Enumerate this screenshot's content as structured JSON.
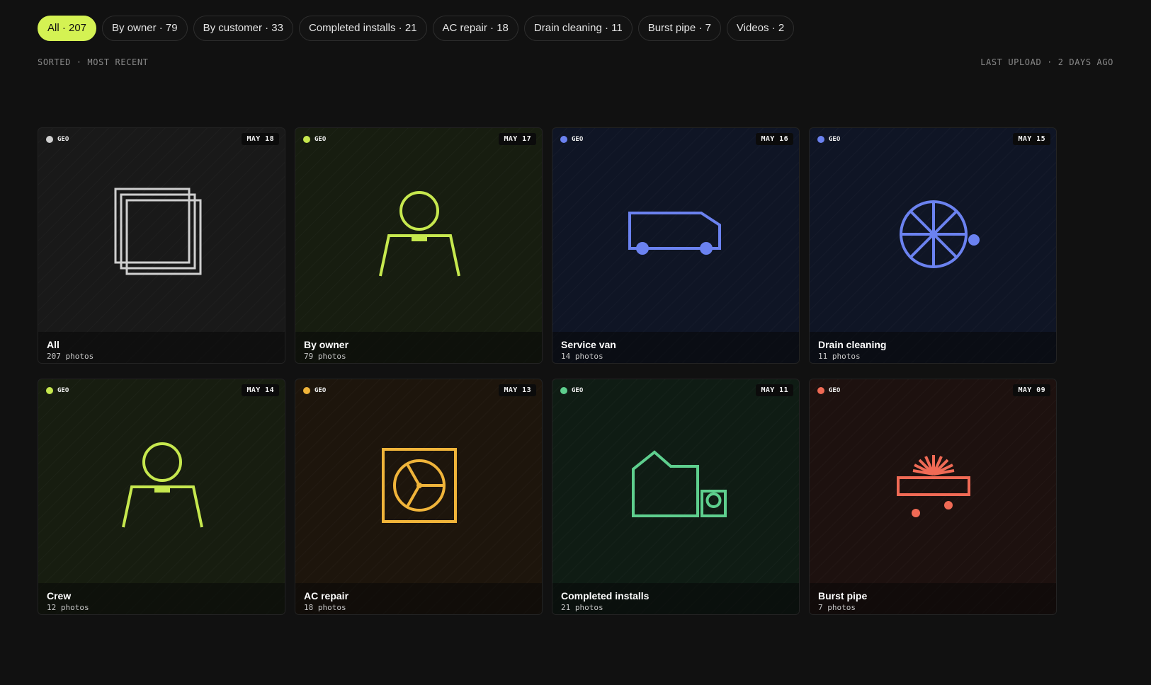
{
  "filters": [
    {
      "label": "All · 207",
      "active": true
    },
    {
      "label": "By owner · 79"
    },
    {
      "label": "By customer · 33"
    },
    {
      "label": "Completed installs · 21"
    },
    {
      "label": "AC repair · 18"
    },
    {
      "label": "Drain cleaning · 11"
    },
    {
      "label": "Burst pipe · 7"
    },
    {
      "label": "Videos · 2"
    }
  ],
  "meta": {
    "sort": "SORTED · MOST RECENT",
    "last_upload": "LAST UPLOAD · 2 DAYS AGO"
  },
  "albums": [
    {
      "title": "All",
      "count": "207 photos",
      "date": "MAY 18",
      "badge": "GEO",
      "icon": "stacked-photos-icon",
      "color": "#cfcfcf",
      "bg": "#191919"
    },
    {
      "title": "By owner",
      "count": "79 photos",
      "date": "MAY 17",
      "badge": "GEO",
      "icon": "person-icon",
      "color": "#c6e84e",
      "bg": "#171d10"
    },
    {
      "title": "Service van",
      "count": "14 photos",
      "date": "MAY 16",
      "badge": "GEO",
      "icon": "van-icon",
      "color": "#6b82f0",
      "bg": "#0f1525"
    },
    {
      "title": "Drain cleaning",
      "count": "11 photos",
      "date": "MAY 15",
      "badge": "GEO",
      "icon": "drain-wheel-icon",
      "color": "#6b82f0",
      "bg": "#0f1525"
    },
    {
      "title": "Crew",
      "count": "12 photos",
      "date": "MAY 14",
      "badge": "GEO",
      "icon": "person-icon",
      "color": "#c6e84e",
      "bg": "#171d10"
    },
    {
      "title": "AC repair",
      "count": "18 photos",
      "date": "MAY 13",
      "badge": "GEO",
      "icon": "ac-fan-icon",
      "color": "#f0b43a",
      "bg": "#1d150c"
    },
    {
      "title": "Completed installs",
      "count": "21 photos",
      "date": "MAY 11",
      "badge": "GEO",
      "icon": "house-unit-icon",
      "color": "#5ecf8e",
      "bg": "#0f1c14"
    },
    {
      "title": "Burst pipe",
      "count": "7 photos",
      "date": "MAY 09",
      "badge": "GEO",
      "icon": "burst-pipe-icon",
      "color": "#f06a55",
      "bg": "#1d110f"
    }
  ]
}
